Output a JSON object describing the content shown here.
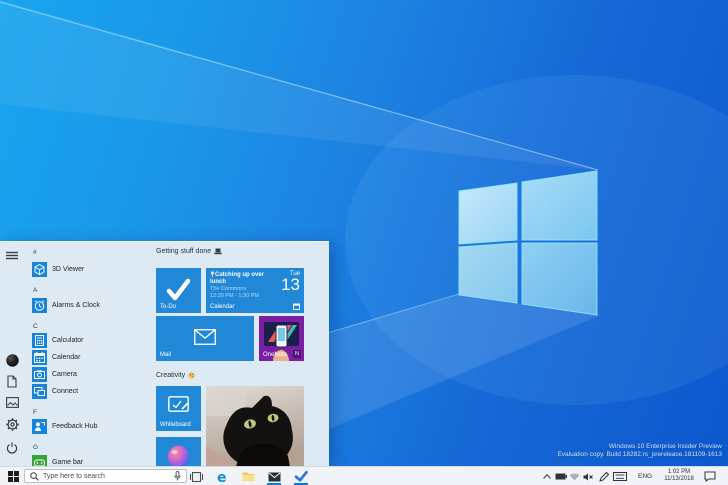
{
  "wallpaper": {
    "watermark_line1": "Windows 10 Enterprise Insider Preview",
    "watermark_line2": "Evaluation copy. Build 18282.rs_prerelease.181109-1613"
  },
  "start_menu": {
    "app_list": [
      {
        "type": "header",
        "label": "#"
      },
      {
        "type": "app",
        "label": "3D Viewer",
        "icon": "3d-viewer-icon"
      },
      {
        "type": "header",
        "label": "A"
      },
      {
        "type": "app",
        "label": "Alarms & Clock",
        "icon": "alarms-clock-icon"
      },
      {
        "type": "header",
        "label": "C"
      },
      {
        "type": "app",
        "label": "Calculator",
        "icon": "calculator-icon"
      },
      {
        "type": "app",
        "label": "Calendar",
        "icon": "calendar-icon"
      },
      {
        "type": "app",
        "label": "Camera",
        "icon": "camera-icon"
      },
      {
        "type": "app",
        "label": "Connect",
        "icon": "connect-icon"
      },
      {
        "type": "header",
        "label": "F"
      },
      {
        "type": "app",
        "label": "Feedback Hub",
        "icon": "feedback-hub-icon"
      },
      {
        "type": "header",
        "label": "G"
      },
      {
        "type": "app",
        "label": "Game bar",
        "icon": "game-bar-icon"
      }
    ],
    "groups": [
      {
        "title": "Getting stuff done",
        "icon": "laptop-emoji"
      },
      {
        "title": "Creativity",
        "icon": "palette-emoji"
      }
    ],
    "tiles": {
      "todo": {
        "label": "To-Do"
      },
      "calendar": {
        "label": "Calendar",
        "event_title": "Catching up over lunch",
        "location": "The Commons",
        "time": "12:30 PM - 1:30 PM",
        "weekday": "Tue",
        "day": "13"
      },
      "mail": {
        "label": "Mail"
      },
      "onenote": {
        "label": "OneNote",
        "badge": "N"
      },
      "whiteboard": {
        "label": "Whiteboard"
      }
    }
  },
  "taskbar": {
    "search": {
      "placeholder": "Type here to search"
    },
    "tray": {
      "language": "ENG",
      "time": "1:02 PM",
      "date": "11/13/2018"
    }
  },
  "colors": {
    "accent": "#0078d7",
    "tile_blue": "#2188d8",
    "onenote_purple": "#7a1fa2",
    "wallpaper_light": "#18a4ee",
    "wallpaper_dark": "#0c57cd"
  }
}
